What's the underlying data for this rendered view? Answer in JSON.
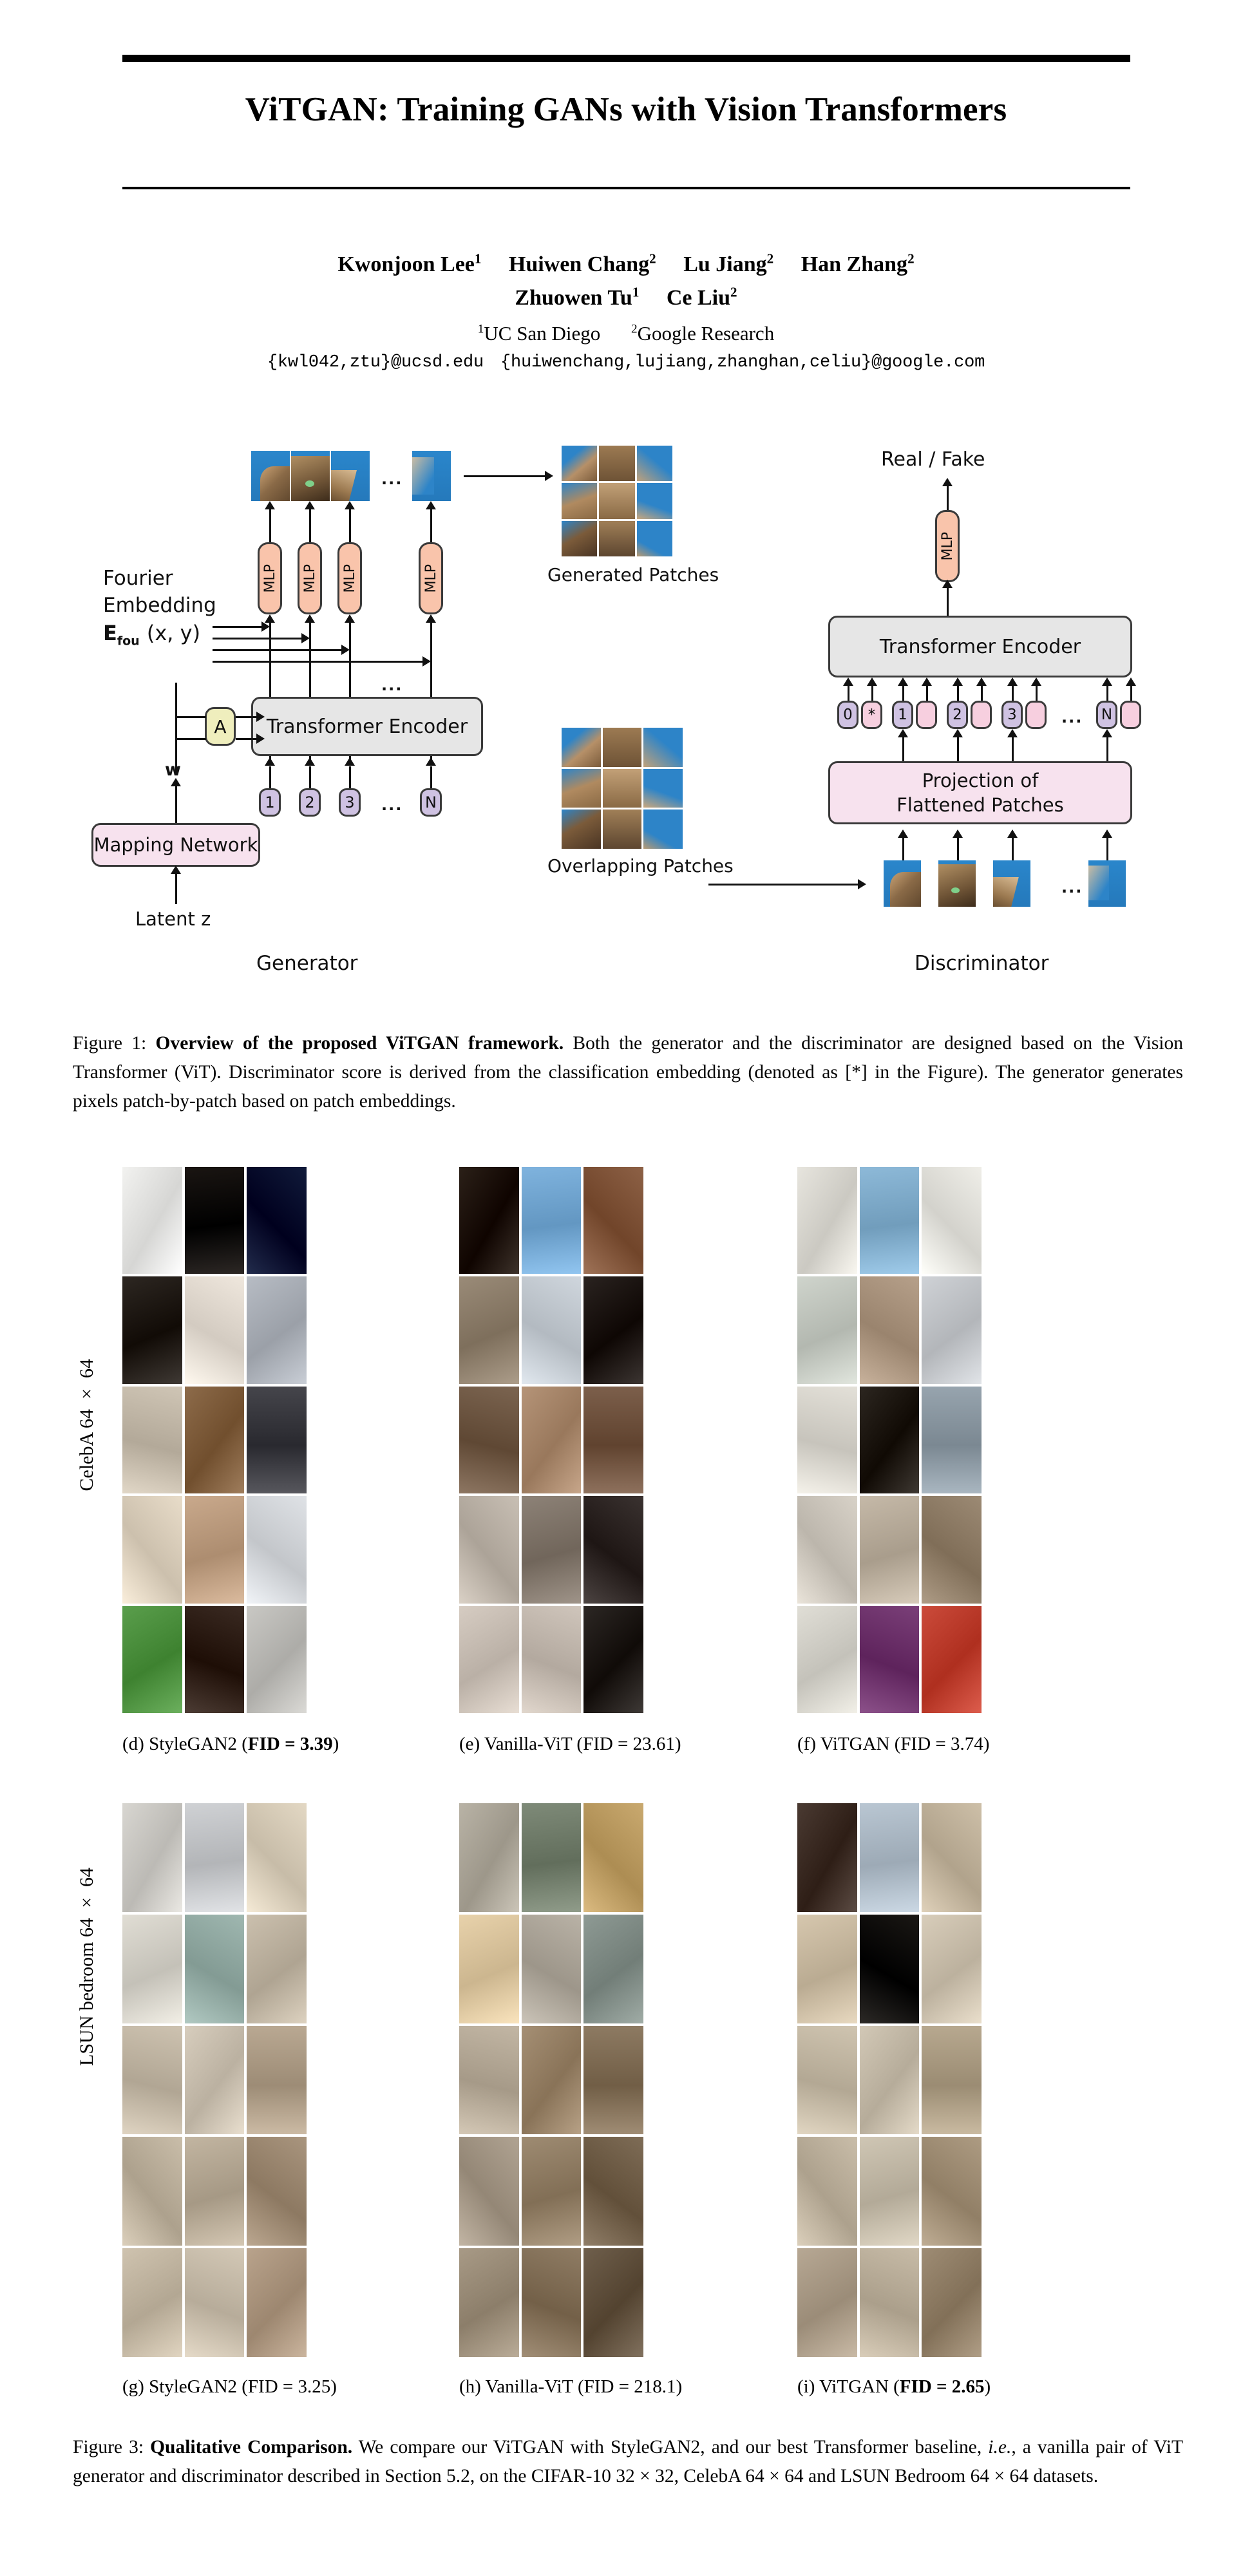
{
  "paper": {
    "title": "ViTGAN: Training GANs with Vision Transformers",
    "authors_line1": "Kwonjoon Lee",
    "authors_line1_b": "Huiwen Chang",
    "authors_line1_c": "Lu Jiang",
    "authors_line1_d": "Han Zhang",
    "authors_line2_a": "Zhuowen Tu",
    "authors_line2_b": "Ce Liu",
    "sup1": "1",
    "sup2": "2",
    "affiliation1": "UC San Diego",
    "affiliation2": "Google Research",
    "email1": "{kwl042,ztu}@ucsd.edu",
    "email2": "{huiwenchang,lujiang,zhanghan,celiu}@google.com"
  },
  "figure1": {
    "generator_label": "Generator",
    "discriminator_label": "Discriminator",
    "fourier_line1": "Fourier",
    "fourier_line2": "Embedding",
    "fourier_formula_base": "E",
    "fourier_formula_sub": "fou",
    "fourier_formula_args": "(x, y)",
    "transformer_encoder": "Transformer Encoder",
    "mlp": "MLP",
    "mapping_network": "Mapping Network",
    "latent": "Latent z",
    "w_label": "w",
    "affine_label": "A",
    "generated_patches": "Generated Patches",
    "overlapping_patches": "Overlapping Patches",
    "projection_line1": "Projection of",
    "projection_line2": "Flattened Patches",
    "real_fake": "Real / Fake",
    "gen_tokens": [
      "1",
      "2",
      "3",
      "N"
    ],
    "disc_tokens": [
      "0",
      "1",
      "2",
      "3",
      "N"
    ],
    "cls_token": "*",
    "ellipsis": "...",
    "colors": {
      "mlp": "#f9c4ab",
      "encoder": "#e6e6e6",
      "mapping": "#f7e2ee",
      "affine": "#efeebd",
      "token_purple": "#cfc2e2",
      "token_pink": "#f7cfdf",
      "sky": "#2d84c8"
    },
    "caption_prefix": "Figure 1:",
    "caption_bold": "Overview of the proposed ViTGAN framework.",
    "caption_rest": " Both the generator and the discriminator are designed based on the Vision Transformer (ViT). Discriminator score is derived from the classification embedding (denoted as [*] in the Figure). The generator generates pixels patch-by-patch based on patch embeddings."
  },
  "figure3": {
    "row1_label": "CelebA 64 × 64",
    "row2_label": "LSUN bedroom 64 × 64",
    "celeba": [
      {
        "id": "d",
        "prefix": "(d) StyleGAN2 (",
        "bold": "FID = 3.39",
        "suffix": ")",
        "bold_all": true
      },
      {
        "id": "e",
        "prefix": "(e) Vanilla-ViT (FID = 23.61)",
        "bold": "",
        "suffix": "",
        "bold_all": false
      },
      {
        "id": "f",
        "prefix": "(f) ViTGAN (FID = 3.74)",
        "bold": "",
        "suffix": "",
        "bold_all": false
      }
    ],
    "lsun": [
      {
        "id": "g",
        "prefix": "(g) StyleGAN2 (FID = 3.25)",
        "bold": "",
        "suffix": "",
        "bold_all": false
      },
      {
        "id": "h",
        "prefix": "(h) Vanilla-ViT (FID = 218.1)",
        "bold": "",
        "suffix": "",
        "bold_all": false
      },
      {
        "id": "i",
        "prefix": "(i) ViTGAN (",
        "bold": "FID = 2.65",
        "suffix": ")",
        "bold_all": true
      }
    ],
    "caption_prefix": "Figure 3:",
    "caption_bold": "Qualitative Comparison.",
    "caption_rest_1": " We compare our ViTGAN with StyleGAN2, and our best Transformer baseline, ",
    "caption_italic": "i.e.",
    "caption_rest_2": ", a vanilla pair of ViT generator and discriminator described in Section 5.2, on the CIFAR-10 32 × 32, CelebA 64 × 64 and LSUN Bedroom 64 × 64 datasets."
  },
  "swatches": {
    "celeba_d": [
      [
        "#f2f2f0",
        "#1a1512",
        "#101a3a"
      ],
      [
        "#2d2722",
        "#efe7dd",
        "#b7bcc4"
      ],
      [
        "#cfc5b5",
        "#8d6b4a",
        "#45454b"
      ],
      [
        "#e8dcc9",
        "#c9a98c",
        "#dfe2e6"
      ],
      [
        "#5a9e4c",
        "#3a2a22",
        "#c9c8c4"
      ]
    ],
    "celeba_e": [
      [
        "#2b2018",
        "#7fb3de",
        "#8d6146"
      ],
      [
        "#9a8b78",
        "#cfd6dd",
        "#2a2320"
      ],
      [
        "#7b6450",
        "#b59478",
        "#7c5f4b"
      ],
      [
        "#c8bfb4",
        "#8d8277",
        "#3a3230"
      ],
      [
        "#d6ccc2",
        "#cfc5bb",
        "#2c2724"
      ]
    ],
    "celeba_f": [
      [
        "#e7e5de",
        "#8db9d8",
        "#efeee8"
      ],
      [
        "#cfd4cc",
        "#b6a08a",
        "#cfd2d6"
      ],
      [
        "#e3e0d8",
        "#2c2620",
        "#97a4ae"
      ],
      [
        "#d8d2c8",
        "#c5b9a8",
        "#9c8a74"
      ],
      [
        "#e0ded6",
        "#7a3f78",
        "#cb4b3b"
      ]
    ],
    "lsun_g": [
      [
        "#d8d6d1",
        "#cfd1d4",
        "#e3d8c4"
      ],
      [
        "#e0ddd4",
        "#9fb7b0",
        "#cbc0ae"
      ],
      [
        "#cdc2b0",
        "#d7cdbd",
        "#b9a892"
      ],
      [
        "#c9bda9",
        "#c2b5a1",
        "#a9957e"
      ],
      [
        "#cfc3af",
        "#d3c8b6",
        "#b9a38c"
      ]
    ],
    "lsun_h": [
      [
        "#b9b3a6",
        "#7e8a78",
        "#c9a96f"
      ],
      [
        "#e8d2ab",
        "#b9b2a6",
        "#8e9a94"
      ],
      [
        "#c2b6a4",
        "#a58f74",
        "#8d7a62"
      ],
      [
        "#b0a392",
        "#9e8b72",
        "#7e6c56"
      ],
      [
        "#a89a86",
        "#8f7c64",
        "#6f5f4c"
      ]
    ],
    "lsun_i": [
      [
        "#4a3a32",
        "#b9c6d2",
        "#cdbfa8"
      ],
      [
        "#d6c7ae",
        "#1a1714",
        "#d8cdba"
      ],
      [
        "#cfc4b0",
        "#d2c8b6",
        "#b7a88f"
      ],
      [
        "#c9bda9",
        "#cfc6b4",
        "#ad9b82"
      ],
      [
        "#b7a894",
        "#c7bba7",
        "#9e8c74"
      ]
    ]
  }
}
